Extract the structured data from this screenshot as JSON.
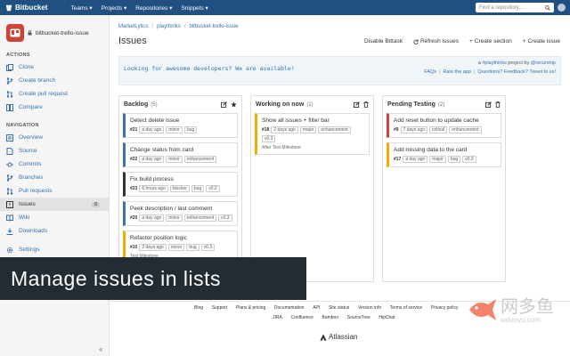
{
  "topnav": {
    "brand": "Bitbucket",
    "menu": [
      "Teams ▾",
      "Projects ▾",
      "Repositories ▾",
      "Snippets ▾"
    ],
    "search_placeholder": "Find a repository…"
  },
  "sidebar": {
    "repo_name": "bitbucket-trello-issue",
    "actions_title": "ACTIONS",
    "actions": [
      {
        "label": "Clone",
        "icon": "clone-icon"
      },
      {
        "label": "Create branch",
        "icon": "branch-icon"
      },
      {
        "label": "Create pull request",
        "icon": "pull-request-icon"
      },
      {
        "label": "Compare",
        "icon": "compare-icon"
      }
    ],
    "navigation_title": "NAVIGATION",
    "navigation": [
      {
        "label": "Overview",
        "icon": "overview-icon"
      },
      {
        "label": "Source",
        "icon": "source-icon"
      },
      {
        "label": "Commits",
        "icon": "commits-icon"
      },
      {
        "label": "Branches",
        "icon": "branches-icon"
      },
      {
        "label": "Pull requests",
        "icon": "pull-requests-icon"
      },
      {
        "label": "Issues",
        "icon": "issues-icon",
        "badge": "8",
        "active": true
      },
      {
        "label": "Wiki",
        "icon": "wiki-icon"
      },
      {
        "label": "Downloads",
        "icon": "downloads-icon"
      }
    ],
    "settings": {
      "label": "Settings",
      "icon": "gear-icon"
    },
    "collapse_label": "«"
  },
  "main": {
    "breadcrumb": [
      "MarketLytics",
      "playthinks",
      "bitbucket-trello-issue"
    ],
    "title": "Issues",
    "actions": [
      {
        "label": "Disable Bittask"
      },
      {
        "label": "Refresh issues",
        "icon": "refresh-icon"
      },
      {
        "label": "Create section",
        "icon": "plus-icon"
      },
      {
        "label": "Create issue",
        "icon": "plus-icon"
      }
    ],
    "banner": {
      "promo": "Looking for awesome developers? We are available!",
      "project_prefix": "a",
      "project_link": "#playthinks",
      "project_mid": "project by",
      "project_author": "@recurship",
      "links": [
        "FAQs",
        "Rate the app",
        "Questions? Feedback? Tweet to us!"
      ]
    },
    "columns": [
      {
        "title": "Backlog",
        "count": "(5)",
        "cards": [
          {
            "type": "task-blue",
            "title": "Detect delete issue",
            "id": "#21",
            "time": "a day ago",
            "tags": [
              "minor",
              "bug"
            ]
          },
          {
            "type": "task-blue",
            "title": "Change status from card",
            "id": "#22",
            "time": "a day ago",
            "tags": [
              "minor",
              "enhancement"
            ]
          },
          {
            "type": "task",
            "title": "Fix build process",
            "id": "#23",
            "time": "6 hours ago",
            "tags": [
              "blocker",
              "bug",
              "v0.2"
            ]
          },
          {
            "type": "task-blue",
            "title": "Peek description / last comment",
            "id": "#20",
            "time": "a day ago",
            "tags": [
              "minor",
              "enhancement",
              "v0.3"
            ]
          },
          {
            "type": "feature",
            "title": "Refactor position logic",
            "id": "#10",
            "time": "2 days ago",
            "tags": [
              "minor",
              "bug",
              "v0.3"
            ],
            "milestone": "Test Milestone"
          }
        ]
      },
      {
        "title": "Working on now",
        "count": "(1)",
        "cards": [
          {
            "type": "feature",
            "title": "Show all issues + filter bar",
            "id": "#18",
            "time": "2 days ago",
            "tags": [
              "major",
              "enhancement",
              "v0.3"
            ],
            "milestone": "After Test Milestone"
          }
        ]
      },
      {
        "title": "Pending Testing",
        "count": "(2)",
        "cards": [
          {
            "type": "bug",
            "title": "Add reset button to update cache",
            "id": "#9",
            "time": "7 days ago",
            "tags": [
              "critical",
              "enhancement"
            ]
          },
          {
            "type": "feature",
            "title": "Add missing data to the card",
            "id": "#17",
            "time": "a day ago",
            "tags": [
              "major",
              "bug",
              "v0.3"
            ]
          }
        ]
      }
    ]
  },
  "footer": {
    "row1": [
      "Blog",
      "Support",
      "Plans & pricing",
      "Documentation",
      "API",
      "Site status",
      "Version info",
      "Terms of service",
      "Privacy policy"
    ],
    "row2": [
      "JIRA",
      "Confluence",
      "Bamboo",
      "SourceTree",
      "HipChat"
    ],
    "brand": "Atlassian"
  },
  "caption": "Manage issues in lists",
  "watermark": {
    "cn": "网多鱼",
    "url": "wduoyu.com"
  }
}
